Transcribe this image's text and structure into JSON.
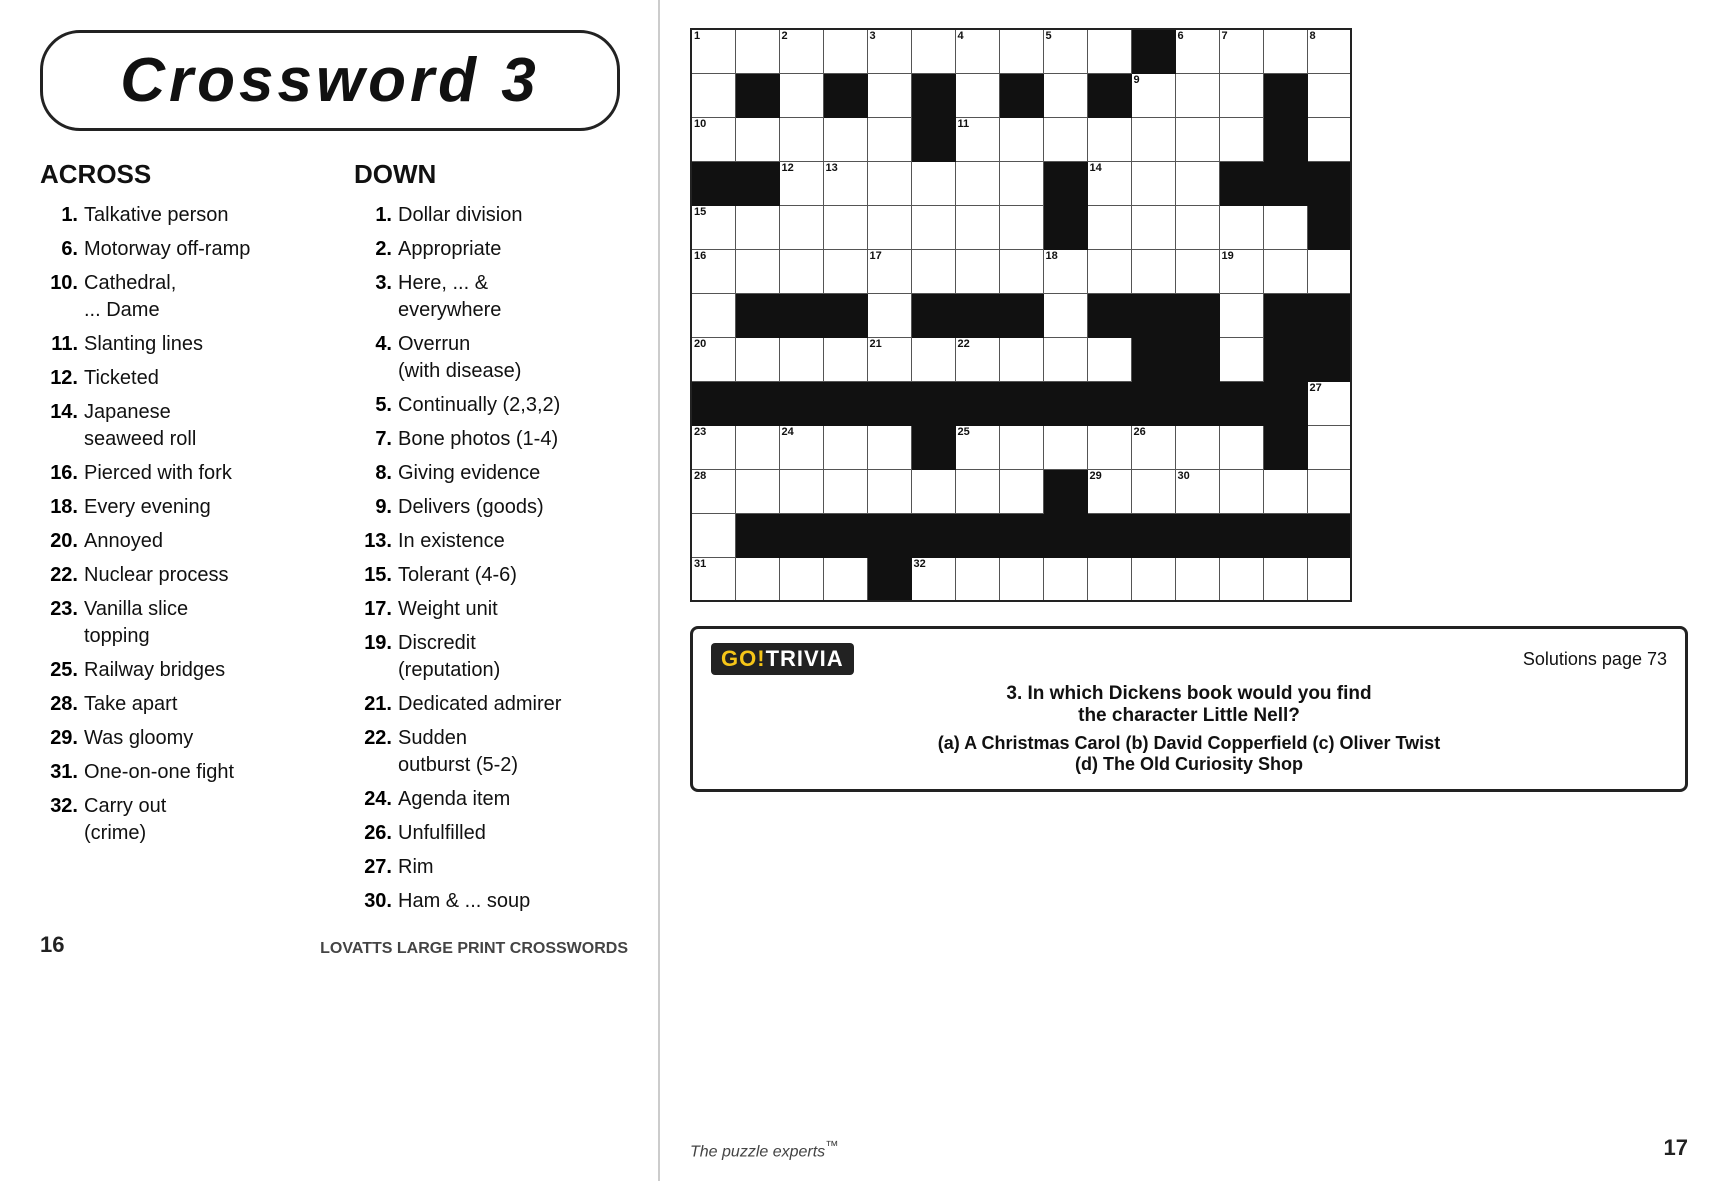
{
  "title": "Crossword   3",
  "across_header": "ACROSS",
  "down_header": "DOWN",
  "across_clues": [
    {
      "num": "1.",
      "text": "Talkative person"
    },
    {
      "num": "6.",
      "text": "Motorway off-ramp"
    },
    {
      "num": "10.",
      "text": "Cathedral,\n... Dame"
    },
    {
      "num": "11.",
      "text": "Slanting lines"
    },
    {
      "num": "12.",
      "text": "Ticketed"
    },
    {
      "num": "14.",
      "text": "Japanese\nseaweed roll"
    },
    {
      "num": "16.",
      "text": "Pierced with fork"
    },
    {
      "num": "18.",
      "text": "Every evening"
    },
    {
      "num": "20.",
      "text": "Annoyed"
    },
    {
      "num": "22.",
      "text": "Nuclear process"
    },
    {
      "num": "23.",
      "text": "Vanilla slice\ntopping"
    },
    {
      "num": "25.",
      "text": "Railway bridges"
    },
    {
      "num": "28.",
      "text": "Take apart"
    },
    {
      "num": "29.",
      "text": "Was gloomy"
    },
    {
      "num": "31.",
      "text": "One-on-one fight"
    },
    {
      "num": "32.",
      "text": "Carry out\n(crime)"
    }
  ],
  "down_clues": [
    {
      "num": "1.",
      "text": "Dollar division"
    },
    {
      "num": "2.",
      "text": "Appropriate"
    },
    {
      "num": "3.",
      "text": "Here, ... &\neverywhere"
    },
    {
      "num": "4.",
      "text": "Overrun\n(with disease)"
    },
    {
      "num": "5.",
      "text": "Continually (2,3,2)"
    },
    {
      "num": "7.",
      "text": "Bone photos (1-4)"
    },
    {
      "num": "8.",
      "text": "Giving evidence"
    },
    {
      "num": "9.",
      "text": "Delivers (goods)"
    },
    {
      "num": "13.",
      "text": "In existence"
    },
    {
      "num": "15.",
      "text": "Tolerant (4-6)"
    },
    {
      "num": "17.",
      "text": "Weight unit"
    },
    {
      "num": "19.",
      "text": "Discredit\n(reputation)"
    },
    {
      "num": "21.",
      "text": "Dedicated admirer"
    },
    {
      "num": "22.",
      "text": "Sudden\noutburst (5-2)"
    },
    {
      "num": "24.",
      "text": "Agenda item"
    },
    {
      "num": "26.",
      "text": "Unfulfilled"
    },
    {
      "num": "27.",
      "text": "Rim"
    },
    {
      "num": "30.",
      "text": "Ham & ... soup"
    }
  ],
  "trivia": {
    "logo_text": "TRIVIA",
    "solutions": "Solutions page 73",
    "question": "3. In which Dickens book would you find\nthe character Little Nell?",
    "answers": "(a) A Christmas Carol (b) David Copperfield (c) Oliver Twist\n(d) The Old Curiosity Shop"
  },
  "footer": {
    "page_left": "16",
    "center_brand": "LOVATTS",
    "center_text": " LARGE PRINT CROSSWORDS",
    "right_label": "The puzzle experts",
    "right_tm": "™",
    "page_right": "17"
  }
}
